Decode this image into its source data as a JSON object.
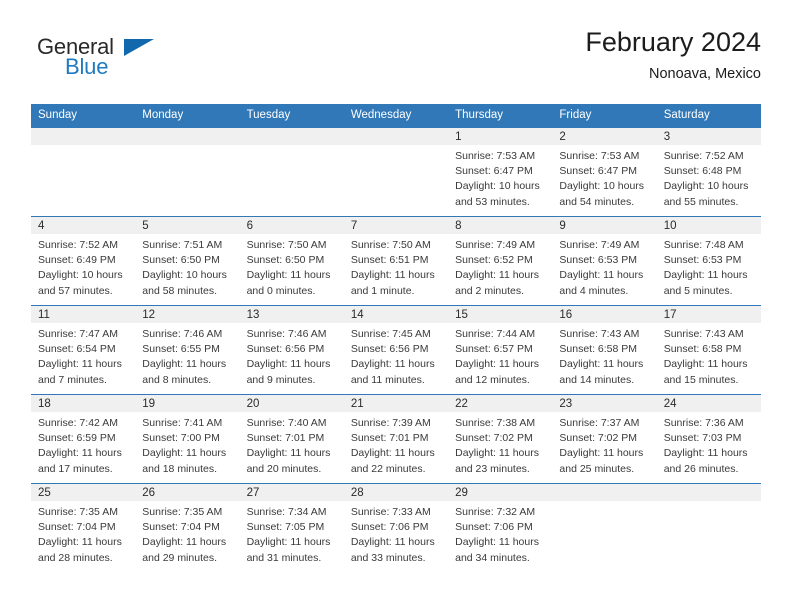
{
  "brand": {
    "word1": "General",
    "word2": "Blue",
    "triangle_color": "#1168ad",
    "blue_text_color": "#1f7bc1"
  },
  "header": {
    "title": "February 2024",
    "subtitle": "Nonoava, Mexico"
  },
  "theme": {
    "header_blue": "#3178b8",
    "daynum_band": "#f0f0f0",
    "text": "#3a3a3a"
  },
  "weekdays": [
    "Sunday",
    "Monday",
    "Tuesday",
    "Wednesday",
    "Thursday",
    "Friday",
    "Saturday"
  ],
  "weeks": [
    [
      {
        "day": "",
        "sunrise": "",
        "sunset": "",
        "daylight_line1": "",
        "daylight_line2": ""
      },
      {
        "day": "",
        "sunrise": "",
        "sunset": "",
        "daylight_line1": "",
        "daylight_line2": ""
      },
      {
        "day": "",
        "sunrise": "",
        "sunset": "",
        "daylight_line1": "",
        "daylight_line2": ""
      },
      {
        "day": "",
        "sunrise": "",
        "sunset": "",
        "daylight_line1": "",
        "daylight_line2": ""
      },
      {
        "day": "1",
        "sunrise": "Sunrise: 7:53 AM",
        "sunset": "Sunset: 6:47 PM",
        "daylight_line1": "Daylight: 10 hours",
        "daylight_line2": "and 53 minutes."
      },
      {
        "day": "2",
        "sunrise": "Sunrise: 7:53 AM",
        "sunset": "Sunset: 6:47 PM",
        "daylight_line1": "Daylight: 10 hours",
        "daylight_line2": "and 54 minutes."
      },
      {
        "day": "3",
        "sunrise": "Sunrise: 7:52 AM",
        "sunset": "Sunset: 6:48 PM",
        "daylight_line1": "Daylight: 10 hours",
        "daylight_line2": "and 55 minutes."
      }
    ],
    [
      {
        "day": "4",
        "sunrise": "Sunrise: 7:52 AM",
        "sunset": "Sunset: 6:49 PM",
        "daylight_line1": "Daylight: 10 hours",
        "daylight_line2": "and 57 minutes."
      },
      {
        "day": "5",
        "sunrise": "Sunrise: 7:51 AM",
        "sunset": "Sunset: 6:50 PM",
        "daylight_line1": "Daylight: 10 hours",
        "daylight_line2": "and 58 minutes."
      },
      {
        "day": "6",
        "sunrise": "Sunrise: 7:50 AM",
        "sunset": "Sunset: 6:50 PM",
        "daylight_line1": "Daylight: 11 hours",
        "daylight_line2": "and 0 minutes."
      },
      {
        "day": "7",
        "sunrise": "Sunrise: 7:50 AM",
        "sunset": "Sunset: 6:51 PM",
        "daylight_line1": "Daylight: 11 hours",
        "daylight_line2": "and 1 minute."
      },
      {
        "day": "8",
        "sunrise": "Sunrise: 7:49 AM",
        "sunset": "Sunset: 6:52 PM",
        "daylight_line1": "Daylight: 11 hours",
        "daylight_line2": "and 2 minutes."
      },
      {
        "day": "9",
        "sunrise": "Sunrise: 7:49 AM",
        "sunset": "Sunset: 6:53 PM",
        "daylight_line1": "Daylight: 11 hours",
        "daylight_line2": "and 4 minutes."
      },
      {
        "day": "10",
        "sunrise": "Sunrise: 7:48 AM",
        "sunset": "Sunset: 6:53 PM",
        "daylight_line1": "Daylight: 11 hours",
        "daylight_line2": "and 5 minutes."
      }
    ],
    [
      {
        "day": "11",
        "sunrise": "Sunrise: 7:47 AM",
        "sunset": "Sunset: 6:54 PM",
        "daylight_line1": "Daylight: 11 hours",
        "daylight_line2": "and 7 minutes."
      },
      {
        "day": "12",
        "sunrise": "Sunrise: 7:46 AM",
        "sunset": "Sunset: 6:55 PM",
        "daylight_line1": "Daylight: 11 hours",
        "daylight_line2": "and 8 minutes."
      },
      {
        "day": "13",
        "sunrise": "Sunrise: 7:46 AM",
        "sunset": "Sunset: 6:56 PM",
        "daylight_line1": "Daylight: 11 hours",
        "daylight_line2": "and 9 minutes."
      },
      {
        "day": "14",
        "sunrise": "Sunrise: 7:45 AM",
        "sunset": "Sunset: 6:56 PM",
        "daylight_line1": "Daylight: 11 hours",
        "daylight_line2": "and 11 minutes."
      },
      {
        "day": "15",
        "sunrise": "Sunrise: 7:44 AM",
        "sunset": "Sunset: 6:57 PM",
        "daylight_line1": "Daylight: 11 hours",
        "daylight_line2": "and 12 minutes."
      },
      {
        "day": "16",
        "sunrise": "Sunrise: 7:43 AM",
        "sunset": "Sunset: 6:58 PM",
        "daylight_line1": "Daylight: 11 hours",
        "daylight_line2": "and 14 minutes."
      },
      {
        "day": "17",
        "sunrise": "Sunrise: 7:43 AM",
        "sunset": "Sunset: 6:58 PM",
        "daylight_line1": "Daylight: 11 hours",
        "daylight_line2": "and 15 minutes."
      }
    ],
    [
      {
        "day": "18",
        "sunrise": "Sunrise: 7:42 AM",
        "sunset": "Sunset: 6:59 PM",
        "daylight_line1": "Daylight: 11 hours",
        "daylight_line2": "and 17 minutes."
      },
      {
        "day": "19",
        "sunrise": "Sunrise: 7:41 AM",
        "sunset": "Sunset: 7:00 PM",
        "daylight_line1": "Daylight: 11 hours",
        "daylight_line2": "and 18 minutes."
      },
      {
        "day": "20",
        "sunrise": "Sunrise: 7:40 AM",
        "sunset": "Sunset: 7:01 PM",
        "daylight_line1": "Daylight: 11 hours",
        "daylight_line2": "and 20 minutes."
      },
      {
        "day": "21",
        "sunrise": "Sunrise: 7:39 AM",
        "sunset": "Sunset: 7:01 PM",
        "daylight_line1": "Daylight: 11 hours",
        "daylight_line2": "and 22 minutes."
      },
      {
        "day": "22",
        "sunrise": "Sunrise: 7:38 AM",
        "sunset": "Sunset: 7:02 PM",
        "daylight_line1": "Daylight: 11 hours",
        "daylight_line2": "and 23 minutes."
      },
      {
        "day": "23",
        "sunrise": "Sunrise: 7:37 AM",
        "sunset": "Sunset: 7:02 PM",
        "daylight_line1": "Daylight: 11 hours",
        "daylight_line2": "and 25 minutes."
      },
      {
        "day": "24",
        "sunrise": "Sunrise: 7:36 AM",
        "sunset": "Sunset: 7:03 PM",
        "daylight_line1": "Daylight: 11 hours",
        "daylight_line2": "and 26 minutes."
      }
    ],
    [
      {
        "day": "25",
        "sunrise": "Sunrise: 7:35 AM",
        "sunset": "Sunset: 7:04 PM",
        "daylight_line1": "Daylight: 11 hours",
        "daylight_line2": "and 28 minutes."
      },
      {
        "day": "26",
        "sunrise": "Sunrise: 7:35 AM",
        "sunset": "Sunset: 7:04 PM",
        "daylight_line1": "Daylight: 11 hours",
        "daylight_line2": "and 29 minutes."
      },
      {
        "day": "27",
        "sunrise": "Sunrise: 7:34 AM",
        "sunset": "Sunset: 7:05 PM",
        "daylight_line1": "Daylight: 11 hours",
        "daylight_line2": "and 31 minutes."
      },
      {
        "day": "28",
        "sunrise": "Sunrise: 7:33 AM",
        "sunset": "Sunset: 7:06 PM",
        "daylight_line1": "Daylight: 11 hours",
        "daylight_line2": "and 33 minutes."
      },
      {
        "day": "29",
        "sunrise": "Sunrise: 7:32 AM",
        "sunset": "Sunset: 7:06 PM",
        "daylight_line1": "Daylight: 11 hours",
        "daylight_line2": "and 34 minutes."
      },
      {
        "day": "",
        "sunrise": "",
        "sunset": "",
        "daylight_line1": "",
        "daylight_line2": ""
      },
      {
        "day": "",
        "sunrise": "",
        "sunset": "",
        "daylight_line1": "",
        "daylight_line2": ""
      }
    ]
  ]
}
